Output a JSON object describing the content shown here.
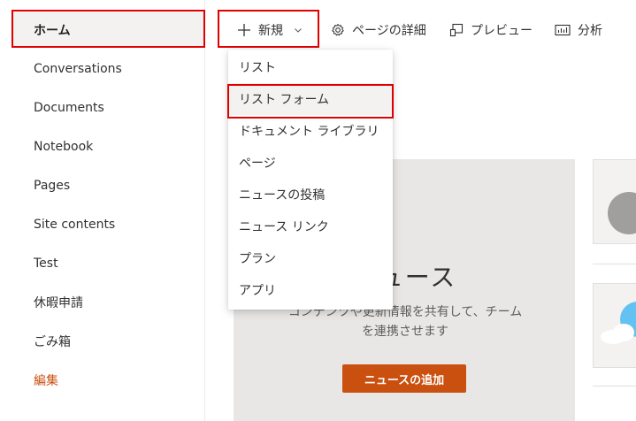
{
  "sidebar": {
    "items": [
      {
        "label": "ホーム"
      },
      {
        "label": "Conversations"
      },
      {
        "label": "Documents"
      },
      {
        "label": "Notebook"
      },
      {
        "label": "Pages"
      },
      {
        "label": "Site contents"
      },
      {
        "label": "Test"
      },
      {
        "label": "休暇申請"
      },
      {
        "label": "ごみ箱"
      },
      {
        "label": "編集"
      }
    ],
    "selected": "ホーム"
  },
  "commandbar": {
    "new_label": "新規",
    "page_details_label": "ページの詳細",
    "preview_label": "プレビュー",
    "analytics_label": "分析"
  },
  "new_menu": {
    "items": [
      {
        "label": "リスト"
      },
      {
        "label": "リスト フォーム"
      },
      {
        "label": "ドキュメント ライブラリ"
      },
      {
        "label": "ページ"
      },
      {
        "label": "ニュースの投稿"
      },
      {
        "label": "ニュース リンク"
      },
      {
        "label": "プラン"
      },
      {
        "label": "アプリ"
      }
    ],
    "highlighted": "リスト フォーム"
  },
  "news": {
    "title": "ニュース",
    "description": "コンテンツや更新情報を共有して、チームを連携させます",
    "add_button": "ニュースの追加"
  },
  "colors": {
    "accent": "#ca5010",
    "highlight_border": "#e00000",
    "selected_bg": "#f3f2f1"
  },
  "icons": [
    "plus-icon",
    "chevron-down-icon",
    "gear-icon",
    "preview-icon",
    "analytics-icon"
  ]
}
